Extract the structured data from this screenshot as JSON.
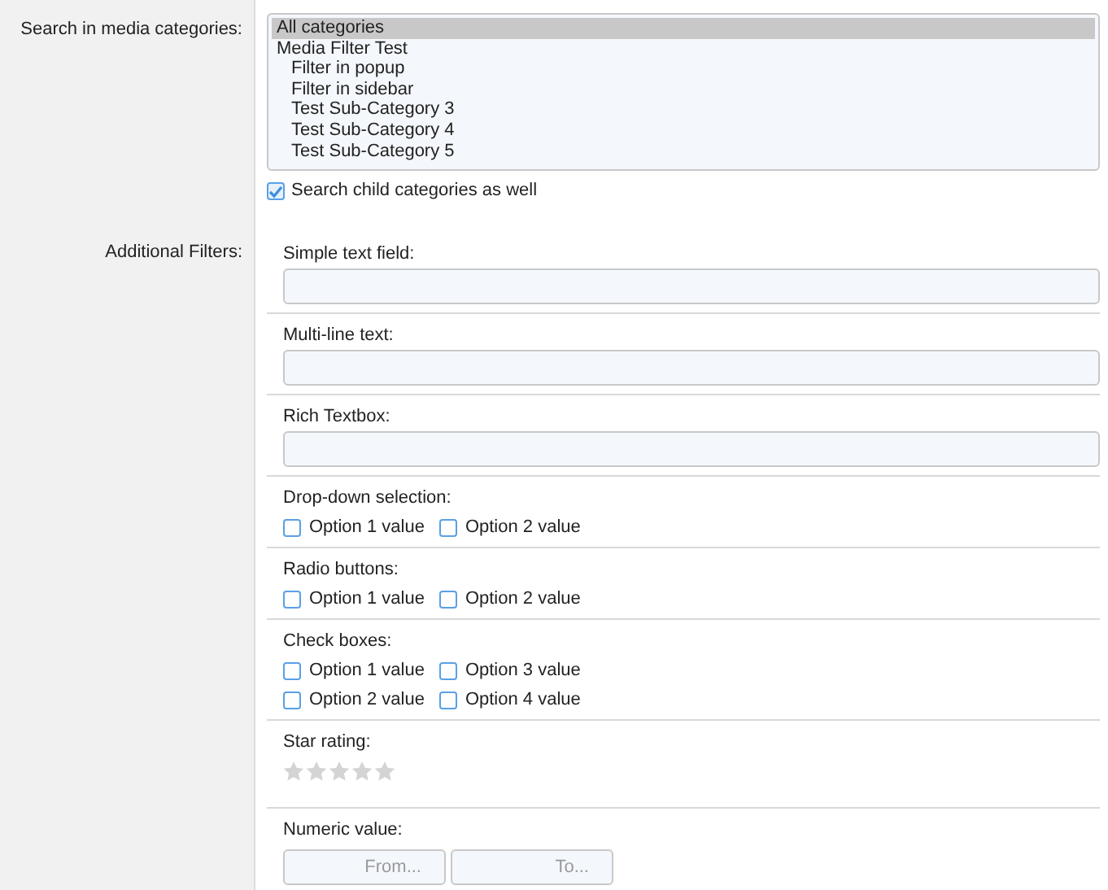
{
  "category_search": {
    "label": "Search in media categories:",
    "categories": [
      {
        "label": "All categories",
        "selected": true
      },
      {
        "label": "Media Filter Test",
        "selected": false,
        "children": [
          {
            "label": "Filter in popup",
            "selected": false
          },
          {
            "label": "Filter in sidebar",
            "selected": false
          },
          {
            "label": "Test Sub-Category 3",
            "selected": false
          },
          {
            "label": "Test Sub-Category 4",
            "selected": false
          },
          {
            "label": "Test Sub-Category 5",
            "selected": false
          }
        ]
      }
    ],
    "include_children": {
      "label": "Search child categories as well",
      "checked": true
    }
  },
  "additional_filters": {
    "label": "Additional Filters:",
    "filters": [
      {
        "kind": "text",
        "label": "Simple text field:"
      },
      {
        "kind": "text",
        "label": "Multi-line text:"
      },
      {
        "kind": "text",
        "label": "Rich Textbox:"
      },
      {
        "kind": "options",
        "label": "Drop-down selection:",
        "options": [
          {
            "label": "Option 1 value",
            "checked": false
          },
          {
            "label": "Option 2 value",
            "checked": false
          }
        ]
      },
      {
        "kind": "options",
        "label": "Radio buttons:",
        "options": [
          {
            "label": "Option 1 value",
            "checked": false
          },
          {
            "label": "Option 2 value",
            "checked": false
          }
        ]
      },
      {
        "kind": "options",
        "label": "Check boxes:",
        "options": [
          {
            "label": "Option 1 value",
            "checked": false
          },
          {
            "label": "Option 2 value",
            "checked": false
          },
          {
            "label": "Option 3 value",
            "checked": false
          },
          {
            "label": "Option 4 value",
            "checked": false
          }
        ]
      },
      {
        "kind": "stars",
        "label": "Star rating:",
        "stars": 0
      },
      {
        "kind": "range",
        "label": "Numeric value:",
        "from_placeholder": "From...",
        "to_placeholder": "To..."
      }
    ]
  }
}
